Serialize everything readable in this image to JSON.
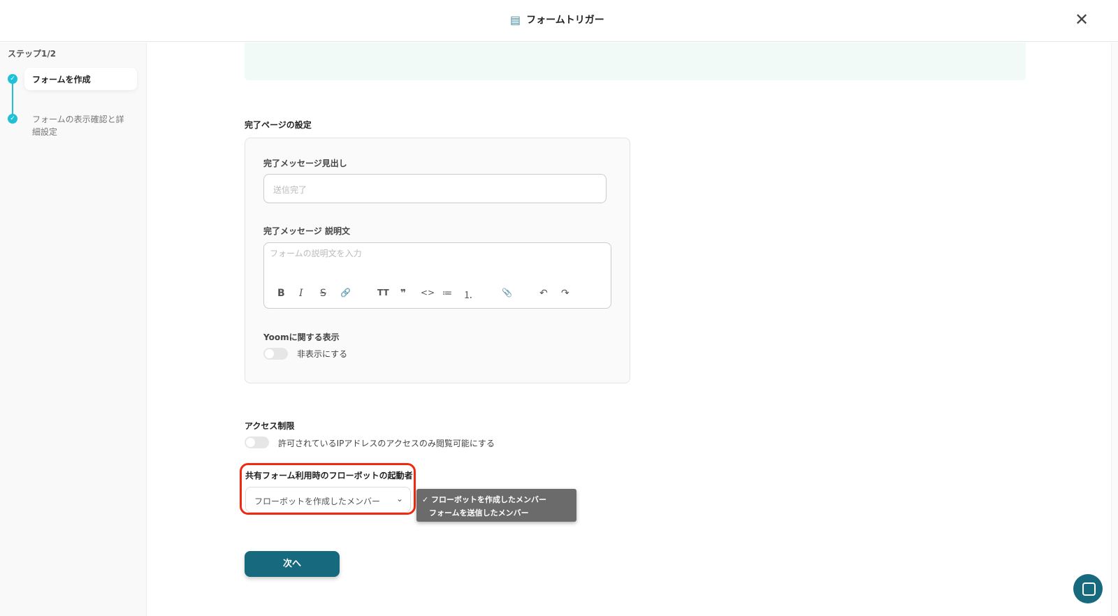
{
  "header": {
    "title": "フォームトリガー",
    "icon": "form-document-icon",
    "close_icon": "close-icon"
  },
  "sidebar": {
    "step_label": "ステップ1/2",
    "steps": [
      {
        "label": "フォームを作成",
        "done": true,
        "active": true
      },
      {
        "label": "フォームの表示確認と詳細設定",
        "done": true,
        "active": false
      }
    ]
  },
  "completion": {
    "section_title": "完了ページの設定",
    "heading_label": "完了メッセージ見出し",
    "heading_placeholder": "送信完了",
    "desc_label": "完了メッセージ 説明文",
    "desc_placeholder": "フォームの説明文を入力",
    "toolbar": [
      "B",
      "I",
      "S",
      "🔗",
      "TT",
      "❞",
      "<>",
      "≔",
      "⒈",
      "📎",
      "↶",
      "↷"
    ],
    "yoom_label": "Yoomに関する表示",
    "yoom_toggle_label": "非表示にする",
    "yoom_toggle_on": false
  },
  "access": {
    "title": "アクセス制限",
    "toggle_label": "許可されているIPアドレスのアクセスのみ閲覧可能にする",
    "toggle_on": false
  },
  "launcher": {
    "title": "共有フォーム利用時のフローボットの起動者",
    "selected": "フローボットを作成したメンバー",
    "options": [
      "✓ フローボットを作成したメンバー",
      "フォームを送信したメンバー"
    ]
  },
  "next_button": "次へ",
  "colors": {
    "accent": "#1fc1d6",
    "primary_button": "#176a7e",
    "highlight": "#f02a12"
  }
}
